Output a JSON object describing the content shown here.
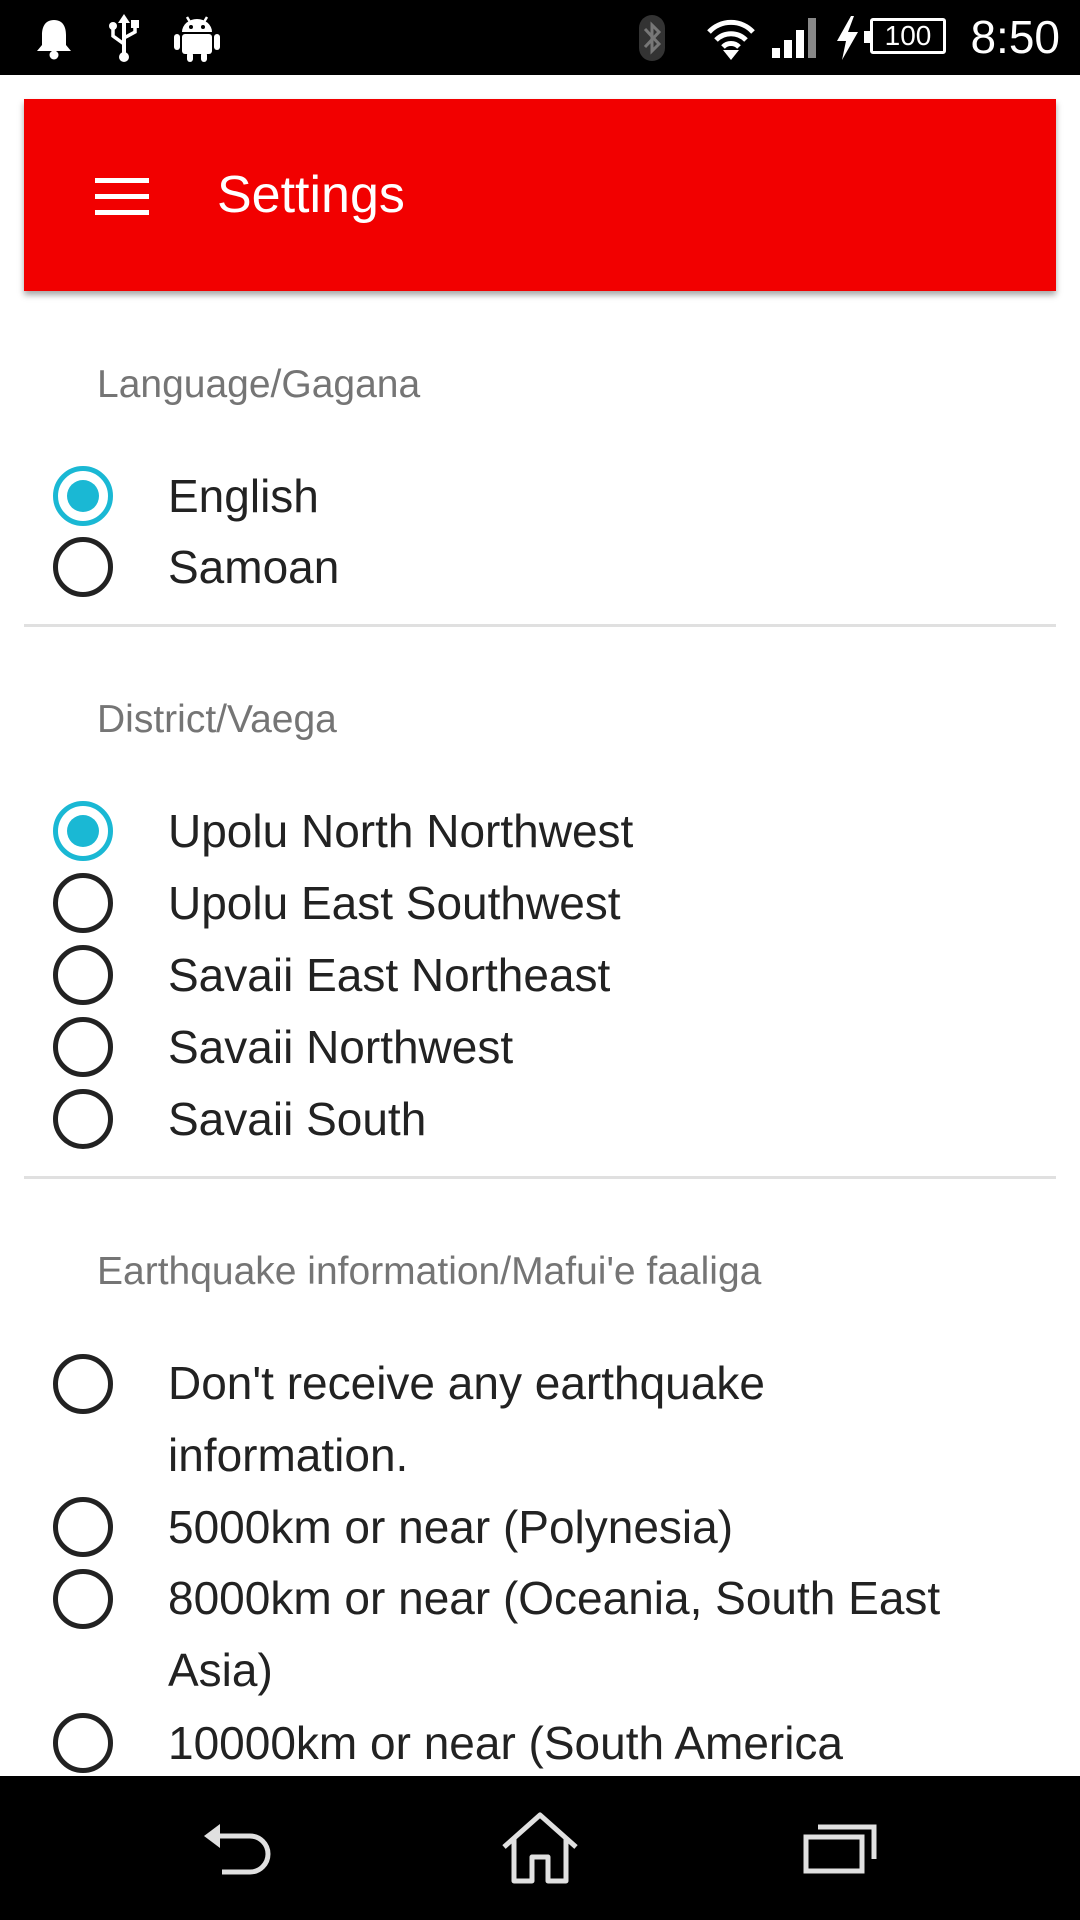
{
  "status_bar": {
    "time": "8:50",
    "battery_level": "100",
    "icons": [
      "bell-icon",
      "usb-icon",
      "android-icon",
      "bluetooth-icon",
      "wifi-icon",
      "signal-icon",
      "charging-icon",
      "battery-icon"
    ]
  },
  "toolbar": {
    "title": "Settings",
    "background_color": "#f20000"
  },
  "accent_color": "#1ab8d4",
  "sections": [
    {
      "title": "Language/Gagana",
      "options": [
        {
          "label": "English",
          "checked": true
        },
        {
          "label": "Samoan",
          "checked": false
        }
      ]
    },
    {
      "title": "District/Vaega",
      "options": [
        {
          "label": "Upolu North Northwest",
          "checked": true
        },
        {
          "label": "Upolu East Southwest",
          "checked": false
        },
        {
          "label": "Savaii East Northeast",
          "checked": false
        },
        {
          "label": "Savaii Northwest",
          "checked": false
        },
        {
          "label": "Savaii South",
          "checked": false
        }
      ]
    },
    {
      "title": "Earthquake information/Mafui'e faaliga",
      "options": [
        {
          "label": "Don't receive any earthquake information.",
          "checked": false
        },
        {
          "label": "5000km or near (Polynesia)",
          "checked": false
        },
        {
          "label": "8000km or near (Oceania, South East Asia)",
          "checked": false
        },
        {
          "label": "10000km or near (South America",
          "checked": false
        }
      ]
    }
  ],
  "nav_bar": {
    "icons": [
      "back-icon",
      "home-icon",
      "recent-apps-icon"
    ]
  }
}
